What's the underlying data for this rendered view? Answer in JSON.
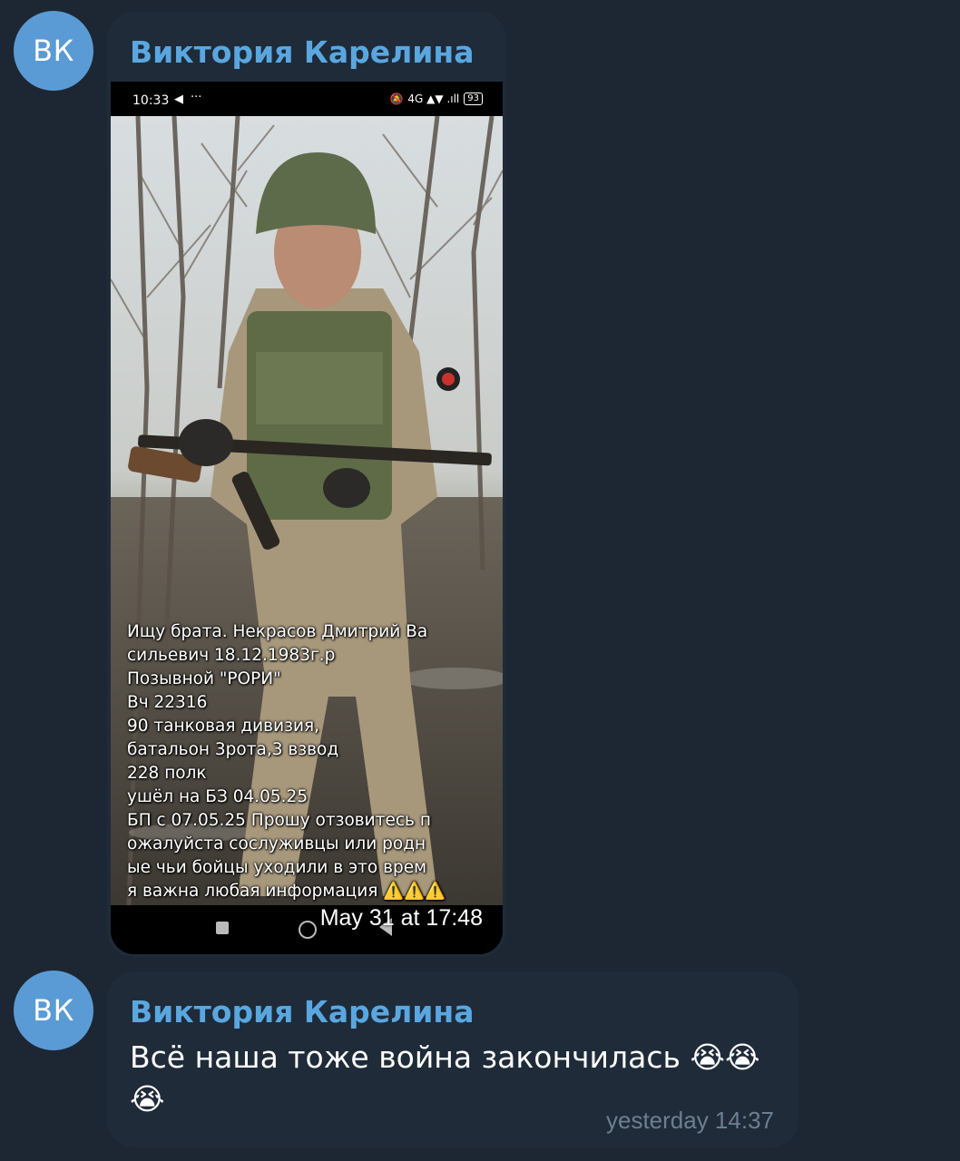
{
  "messages": [
    {
      "avatar_initials": "ВК",
      "sender": "Виктория Карелина",
      "type": "photo",
      "screenshot": {
        "status_time": "10:33",
        "status_icons": "4G ▲▼ .ıll",
        "battery": "93",
        "overlay_text": "Ищу брата. Некрасов Дмитрий Ва\nсильевич 18.12.1983г.р\nПозывной \"РОРИ\"\nВч 22316\n90 танковая дивизия,\nбатальон 3рота,3 взвод\n 228 полк\nушёл на БЗ 04.05.25\nБП с 07.05.25 Прошу отзовитесь п\nожалуйста сослуживцы или родн\nые чьи бойцы уходили в это врем\nя важна любая информация ⚠️⚠️⚠️"
      },
      "timestamp": "May 31 at 17:48"
    },
    {
      "avatar_initials": "ВК",
      "sender": "Виктория Карелина",
      "type": "text",
      "text": "Всё наша тоже война закончилась 😭😭😭",
      "timestamp": "yesterday 14:37"
    }
  ],
  "colors": {
    "background": "#1d2733",
    "bubble": "#1f2b39",
    "sender_name": "#5aa7e0",
    "avatar": "#5b9bd5",
    "time_text": "#6d7f8f"
  }
}
